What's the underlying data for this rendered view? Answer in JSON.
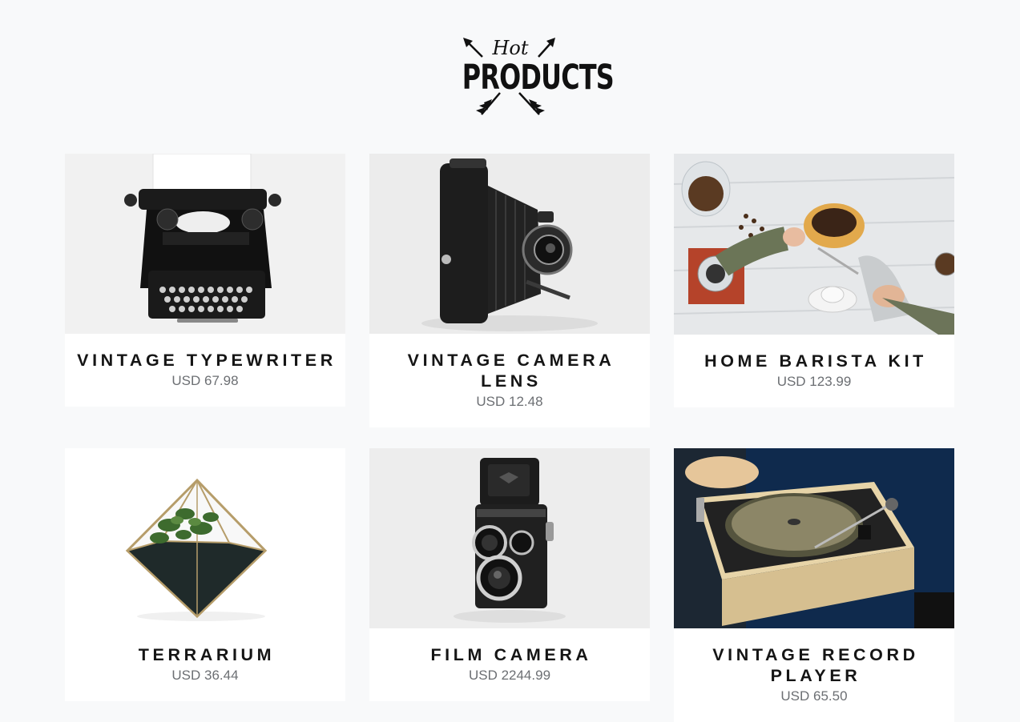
{
  "logo": {
    "script": "Hot",
    "main": "PRODUCTS"
  },
  "products": [
    {
      "name": "VINTAGE TYPEWRITER",
      "price": "USD 67.98",
      "image": "typewriter-image"
    },
    {
      "name": "VINTAGE CAMERA LENS",
      "price": "USD 12.48",
      "image": "folding-camera-image"
    },
    {
      "name": "HOME BARISTA KIT",
      "price": "USD 123.99",
      "image": "barista-kit-image"
    },
    {
      "name": "TERRARIUM",
      "price": "USD 36.44",
      "image": "terrarium-image"
    },
    {
      "name": "FILM CAMERA",
      "price": "USD 2244.99",
      "image": "film-camera-image"
    },
    {
      "name": "VINTAGE RECORD PLAYER",
      "price": "USD 65.50",
      "image": "record-player-image"
    }
  ]
}
